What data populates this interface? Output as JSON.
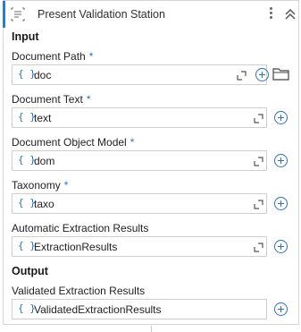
{
  "header": {
    "title": "Present Validation Station"
  },
  "sections": {
    "input": "Input",
    "output": "Output"
  },
  "required_mark": "*",
  "fields": {
    "document_path": {
      "label": "Document Path",
      "value": "doc",
      "required": true
    },
    "document_text": {
      "label": "Document Text",
      "value": "text",
      "required": true
    },
    "document_object_model": {
      "label": "Document Object Model",
      "value": "dom",
      "required": true
    },
    "taxonomy": {
      "label": "Taxonomy",
      "value": "taxo",
      "required": true
    },
    "automatic_extraction_results": {
      "label": "Automatic Extraction Results",
      "value": "ExtractionResults",
      "required": false
    },
    "validated_extraction_results": {
      "label": "Validated Extraction Results",
      "value": "ValidatedExtractionResults",
      "required": false
    }
  },
  "expression_glyph": "{ }",
  "icons": {
    "activity": "activity-icon",
    "menu": "kebab-menu-icon",
    "collapse": "double-chevron-up-icon",
    "expand": "expand-editor-icon",
    "add": "plus-circle-icon",
    "browse": "folder-icon"
  },
  "colors": {
    "accent": "#2b7bd6",
    "brace": "#2b6fc9"
  }
}
